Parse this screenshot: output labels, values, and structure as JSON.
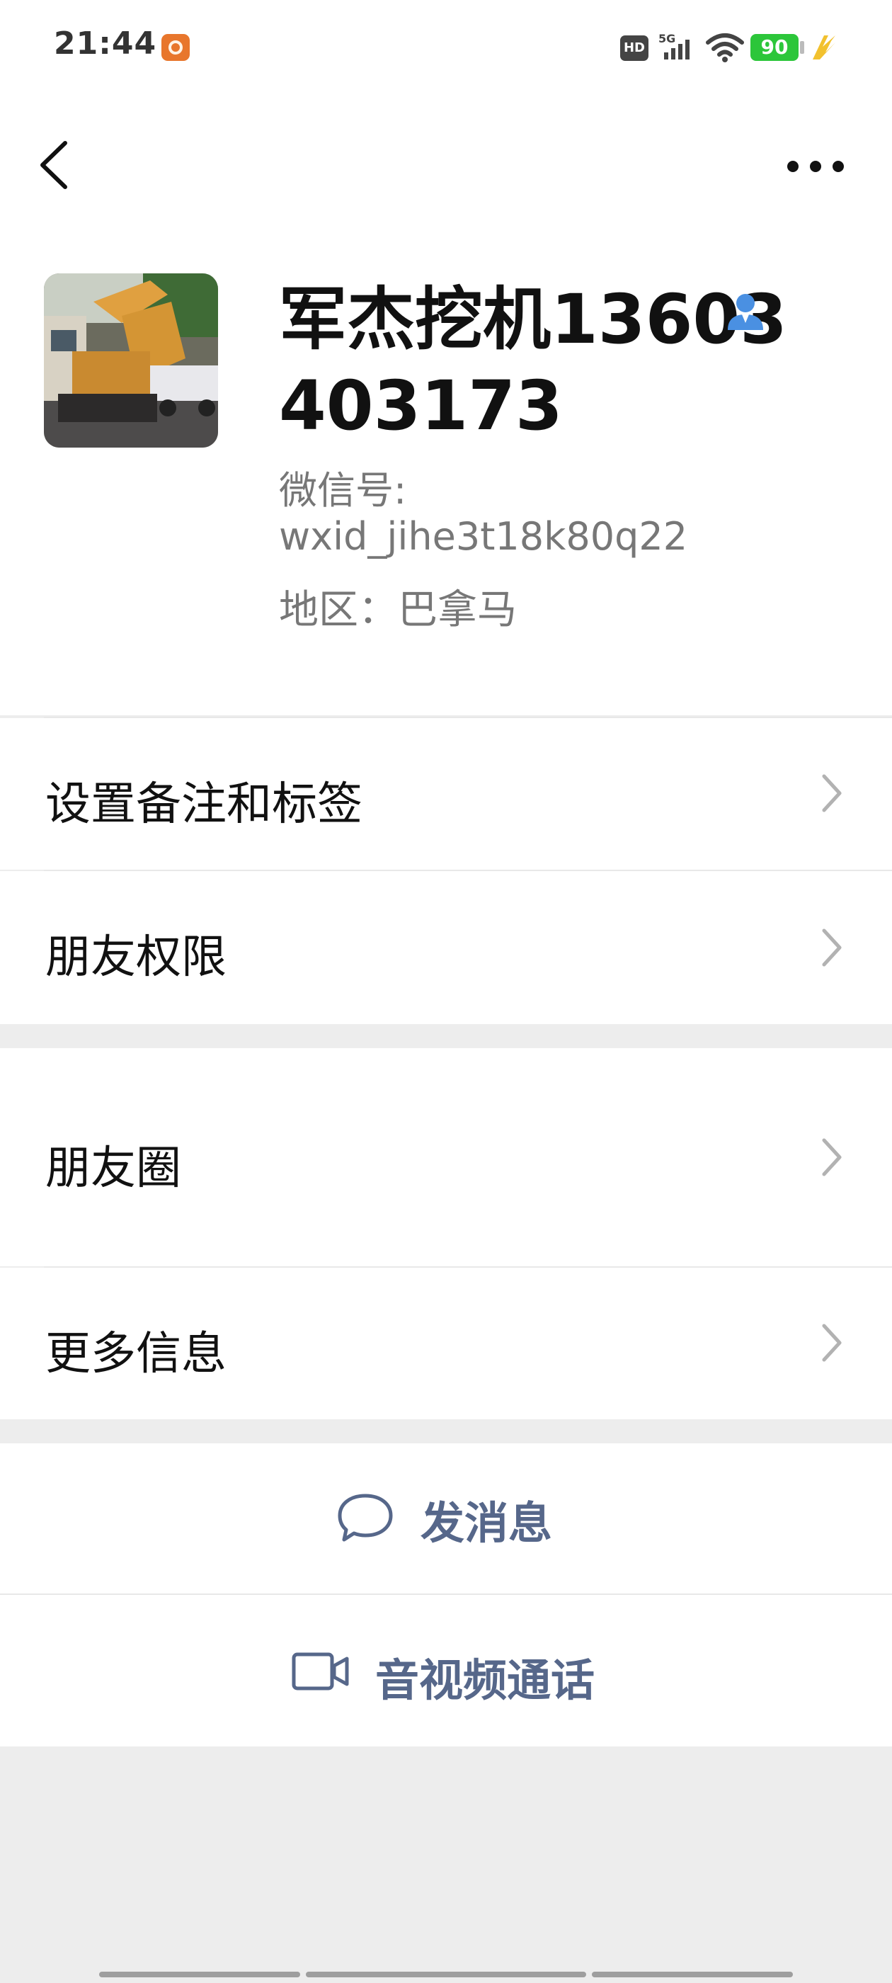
{
  "status_bar": {
    "time": "21:44",
    "hd_label": "HD",
    "network_label": "5G",
    "battery_level": "90",
    "icons": [
      "app-notification-icon",
      "hd-icon",
      "signal-5g-icon",
      "wifi-icon",
      "battery-icon",
      "charging-icon"
    ]
  },
  "nav": {
    "back_icon": "chevron-left-icon",
    "more_icon": "more-horizontal-icon"
  },
  "profile": {
    "name": "军杰挖机13603403173",
    "wxid_label": "微信号:",
    "wxid": "wxid_jihe3t18k80q22",
    "region": "地区：巴拿马",
    "verified_icon": "person-icon",
    "verified_color": "#4a90e2"
  },
  "menu": {
    "remark_tags": "设置备注和标签",
    "friend_permissions": "朋友权限",
    "moments": "朋友圈",
    "more_info": "更多信息"
  },
  "actions": {
    "send_message": "发消息",
    "av_call": "音视频通话",
    "accent_color": "#56678a"
  }
}
